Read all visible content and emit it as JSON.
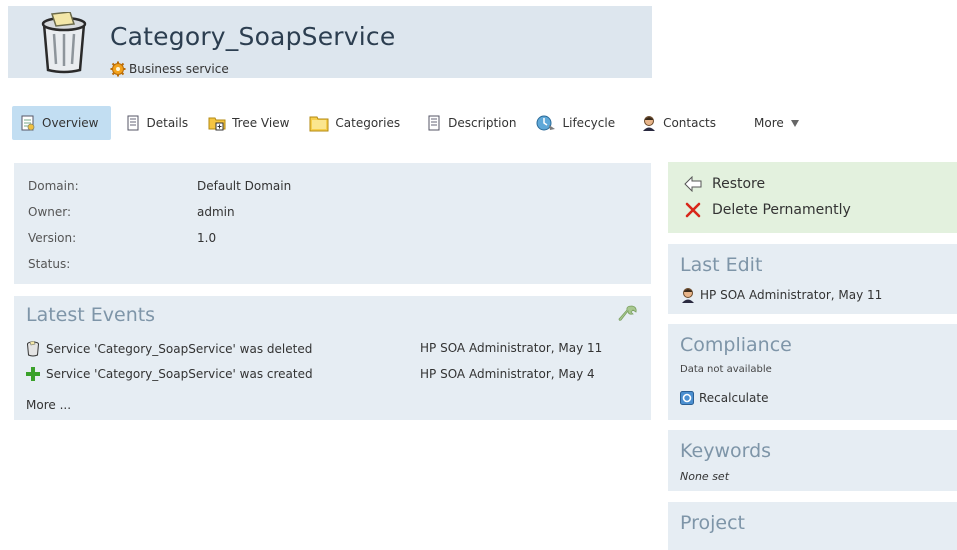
{
  "header": {
    "title": "Category_SoapService",
    "subtitle": "Business service"
  },
  "tabs": [
    {
      "label": "Overview",
      "icon": "overview-icon"
    },
    {
      "label": "Details",
      "icon": "document-icon"
    },
    {
      "label": "Tree View",
      "icon": "tree-view-icon"
    },
    {
      "label": "Categories",
      "icon": "folder-icon"
    },
    {
      "label": "Description",
      "icon": "document-icon"
    },
    {
      "label": "Lifecycle",
      "icon": "lifecycle-icon"
    },
    {
      "label": "Contacts",
      "icon": "contact-icon"
    },
    {
      "label": "More",
      "icon": "triangle-down-icon"
    }
  ],
  "info": {
    "domain_label": "Domain:",
    "domain_value": "Default Domain",
    "owner_label": "Owner:",
    "owner_value": "admin",
    "version_label": "Version:",
    "version_value": "1.0",
    "status_label": "Status:",
    "status_value": ""
  },
  "events": {
    "title": "Latest Events",
    "items": [
      {
        "text": "Service 'Category_SoapService' was deleted",
        "meta": "HP SOA Administrator, May 11",
        "icon": "trash-icon"
      },
      {
        "text": "Service 'Category_SoapService' was created",
        "meta": "HP SOA Administrator, May 4",
        "icon": "plus-icon"
      }
    ],
    "more": "More ..."
  },
  "actions": {
    "restore": "Restore",
    "delete": "Delete Pernamently"
  },
  "last_edit": {
    "title": "Last Edit",
    "value": "HP SOA Administrator, May 11"
  },
  "compliance": {
    "title": "Compliance",
    "status": "Data not available",
    "recalculate": "Recalculate"
  },
  "keywords": {
    "title": "Keywords",
    "value": "None set"
  },
  "project": {
    "title": "Project"
  },
  "colors": {
    "header_bg": "#dde6ee",
    "panel_bg": "#e6edf3",
    "actions_bg": "#e3f1de",
    "tab_active_bg": "#c2def2",
    "panel_title": "#7e95a8",
    "delete_red": "#d8261a",
    "create_green": "#3aa12a"
  }
}
